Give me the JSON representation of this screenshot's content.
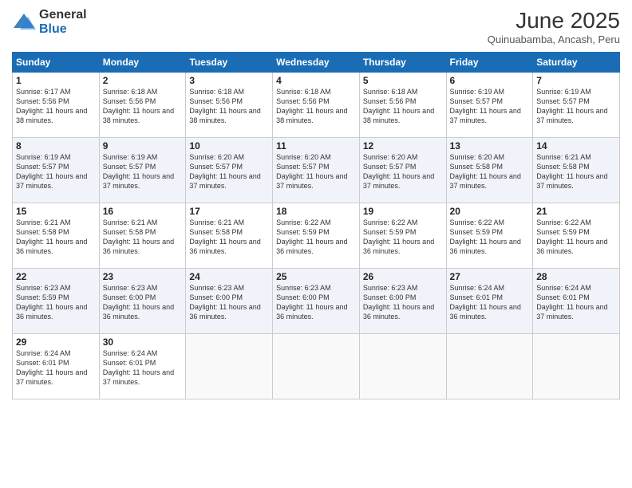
{
  "logo": {
    "general": "General",
    "blue": "Blue"
  },
  "header": {
    "month": "June 2025",
    "location": "Quinuabamba, Ancash, Peru"
  },
  "days": [
    "Sunday",
    "Monday",
    "Tuesday",
    "Wednesday",
    "Thursday",
    "Friday",
    "Saturday"
  ],
  "weeks": [
    [
      {
        "num": "1",
        "rise": "6:17 AM",
        "set": "5:56 PM",
        "daylight": "11 hours and 38 minutes."
      },
      {
        "num": "2",
        "rise": "6:18 AM",
        "set": "5:56 PM",
        "daylight": "11 hours and 38 minutes."
      },
      {
        "num": "3",
        "rise": "6:18 AM",
        "set": "5:56 PM",
        "daylight": "11 hours and 38 minutes."
      },
      {
        "num": "4",
        "rise": "6:18 AM",
        "set": "5:56 PM",
        "daylight": "11 hours and 38 minutes."
      },
      {
        "num": "5",
        "rise": "6:18 AM",
        "set": "5:56 PM",
        "daylight": "11 hours and 38 minutes."
      },
      {
        "num": "6",
        "rise": "6:19 AM",
        "set": "5:57 PM",
        "daylight": "11 hours and 37 minutes."
      },
      {
        "num": "7",
        "rise": "6:19 AM",
        "set": "5:57 PM",
        "daylight": "11 hours and 37 minutes."
      }
    ],
    [
      {
        "num": "8",
        "rise": "6:19 AM",
        "set": "5:57 PM",
        "daylight": "11 hours and 37 minutes."
      },
      {
        "num": "9",
        "rise": "6:19 AM",
        "set": "5:57 PM",
        "daylight": "11 hours and 37 minutes."
      },
      {
        "num": "10",
        "rise": "6:20 AM",
        "set": "5:57 PM",
        "daylight": "11 hours and 37 minutes."
      },
      {
        "num": "11",
        "rise": "6:20 AM",
        "set": "5:57 PM",
        "daylight": "11 hours and 37 minutes."
      },
      {
        "num": "12",
        "rise": "6:20 AM",
        "set": "5:57 PM",
        "daylight": "11 hours and 37 minutes."
      },
      {
        "num": "13",
        "rise": "6:20 AM",
        "set": "5:58 PM",
        "daylight": "11 hours and 37 minutes."
      },
      {
        "num": "14",
        "rise": "6:21 AM",
        "set": "5:58 PM",
        "daylight": "11 hours and 37 minutes."
      }
    ],
    [
      {
        "num": "15",
        "rise": "6:21 AM",
        "set": "5:58 PM",
        "daylight": "11 hours and 36 minutes."
      },
      {
        "num": "16",
        "rise": "6:21 AM",
        "set": "5:58 PM",
        "daylight": "11 hours and 36 minutes."
      },
      {
        "num": "17",
        "rise": "6:21 AM",
        "set": "5:58 PM",
        "daylight": "11 hours and 36 minutes."
      },
      {
        "num": "18",
        "rise": "6:22 AM",
        "set": "5:59 PM",
        "daylight": "11 hours and 36 minutes."
      },
      {
        "num": "19",
        "rise": "6:22 AM",
        "set": "5:59 PM",
        "daylight": "11 hours and 36 minutes."
      },
      {
        "num": "20",
        "rise": "6:22 AM",
        "set": "5:59 PM",
        "daylight": "11 hours and 36 minutes."
      },
      {
        "num": "21",
        "rise": "6:22 AM",
        "set": "5:59 PM",
        "daylight": "11 hours and 36 minutes."
      }
    ],
    [
      {
        "num": "22",
        "rise": "6:23 AM",
        "set": "5:59 PM",
        "daylight": "11 hours and 36 minutes."
      },
      {
        "num": "23",
        "rise": "6:23 AM",
        "set": "6:00 PM",
        "daylight": "11 hours and 36 minutes."
      },
      {
        "num": "24",
        "rise": "6:23 AM",
        "set": "6:00 PM",
        "daylight": "11 hours and 36 minutes."
      },
      {
        "num": "25",
        "rise": "6:23 AM",
        "set": "6:00 PM",
        "daylight": "11 hours and 36 minutes."
      },
      {
        "num": "26",
        "rise": "6:23 AM",
        "set": "6:00 PM",
        "daylight": "11 hours and 36 minutes."
      },
      {
        "num": "27",
        "rise": "6:24 AM",
        "set": "6:01 PM",
        "daylight": "11 hours and 36 minutes."
      },
      {
        "num": "28",
        "rise": "6:24 AM",
        "set": "6:01 PM",
        "daylight": "11 hours and 37 minutes."
      }
    ],
    [
      {
        "num": "29",
        "rise": "6:24 AM",
        "set": "6:01 PM",
        "daylight": "11 hours and 37 minutes."
      },
      {
        "num": "30",
        "rise": "6:24 AM",
        "set": "6:01 PM",
        "daylight": "11 hours and 37 minutes."
      },
      null,
      null,
      null,
      null,
      null
    ]
  ]
}
